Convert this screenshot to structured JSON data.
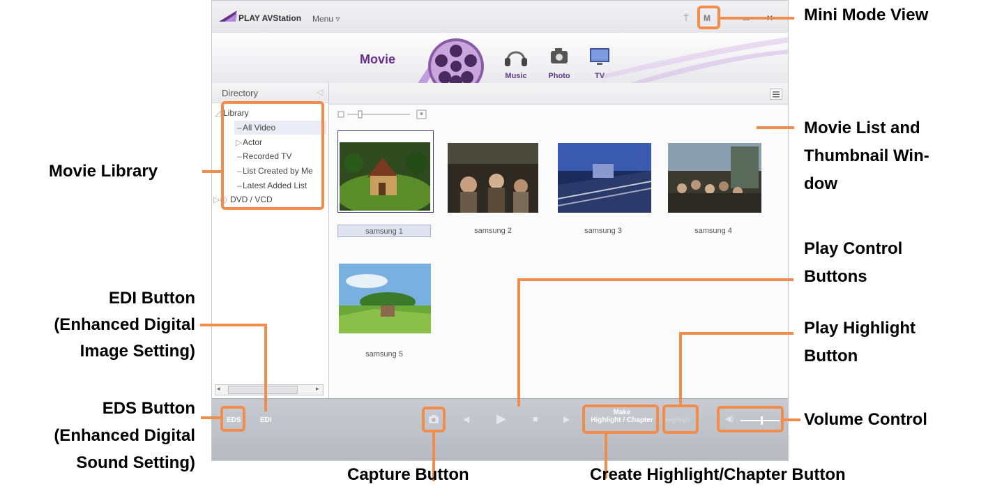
{
  "app": {
    "title": "PLAY AVStation",
    "menu_label": "Menu ▿",
    "window_buttons": [
      "⍑",
      "M",
      "—",
      "▭",
      "✕"
    ]
  },
  "modes": {
    "active": "Movie",
    "items": [
      {
        "label": "Music",
        "icon": "headphones-icon"
      },
      {
        "label": "Photo",
        "icon": "camera-icon"
      },
      {
        "label": "TV",
        "icon": "tv-icon"
      }
    ]
  },
  "sidebar": {
    "header": "Directory",
    "root": "Library",
    "items": [
      "All Video",
      "Actor",
      "Recorded TV",
      "List Created by Me",
      "Latest Added List"
    ],
    "selected": "All Video",
    "dvd": "DVD / VCD"
  },
  "thumbnails": [
    {
      "caption": "samsung 1",
      "selected": true
    },
    {
      "caption": "samsung 2",
      "selected": false
    },
    {
      "caption": "samsung 3",
      "selected": false
    },
    {
      "caption": "samsung 4",
      "selected": false
    },
    {
      "caption": "samsung 5",
      "selected": false
    }
  ],
  "controls": {
    "eds": "EDS",
    "edi": "EDI",
    "make_highlight": "Make",
    "make_highlight_2": "Highlight / Chapter",
    "highlight": "Highligh",
    "volume_level": 0.55
  },
  "callouts": {
    "mini_mode": "Mini Mode View",
    "movie_list_1": "Movie List and",
    "movie_list_2": "Thumbnail Win-",
    "movie_list_3": "dow",
    "movie_library": "Movie Library",
    "play_control_1": "Play Control",
    "play_control_2": "Buttons",
    "edi_1": "EDI Button",
    "edi_2": "(Enhanced Digital",
    "edi_3": "Image Setting)",
    "play_highlight_1": "Play Highlight",
    "play_highlight_2": "Button",
    "eds_1": "EDS Button",
    "eds_2": "(Enhanced Digital",
    "eds_3": "Sound Setting)",
    "volume": "Volume Control",
    "capture": "Capture Button",
    "create_highlight": "Create Highlight/Chapter Button"
  },
  "colors": {
    "accent": "#f28c4b",
    "brand": "#6a2e8c"
  }
}
